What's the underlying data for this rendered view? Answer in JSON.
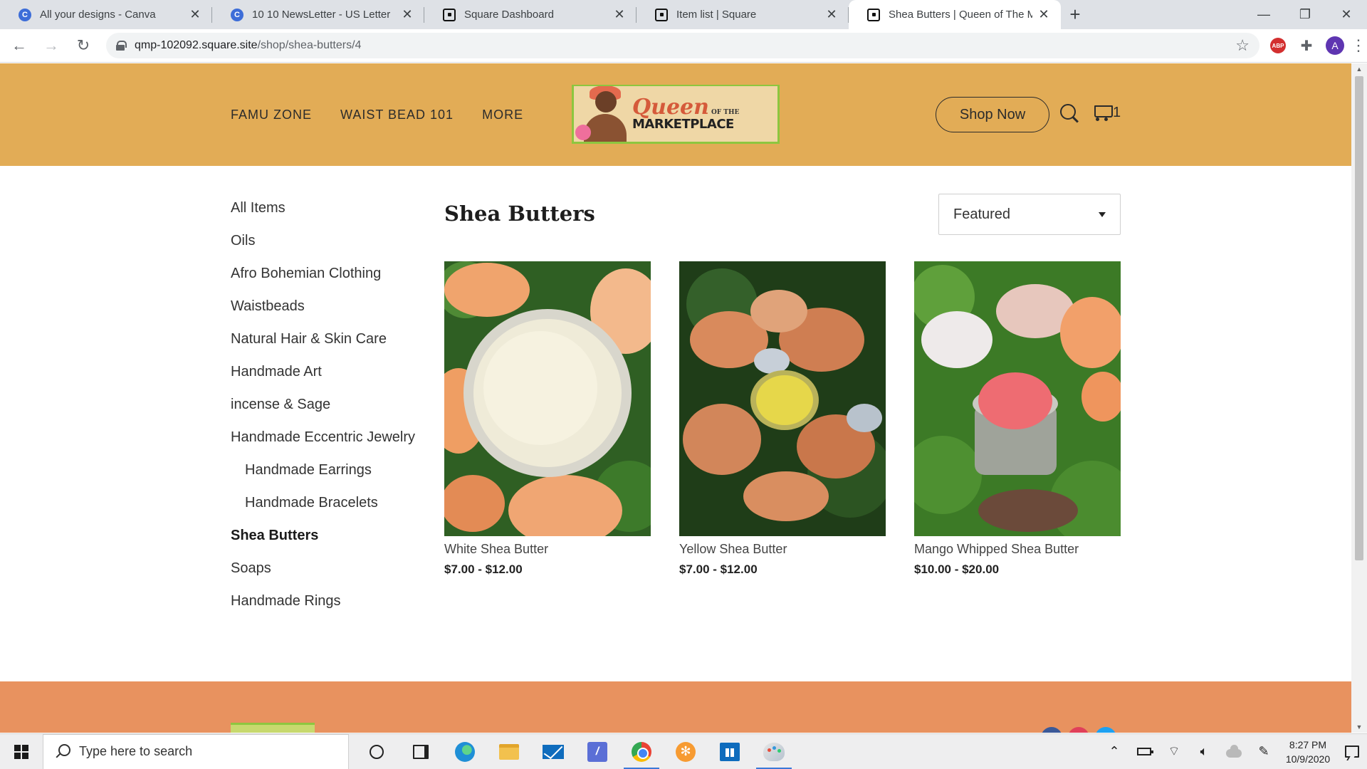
{
  "browser": {
    "tabs": [
      {
        "title": "All your designs - Canva",
        "icon": "canva-favicon",
        "active": false
      },
      {
        "title": "10 10 NewsLetter - US Letter",
        "icon": "canva-favicon",
        "active": false
      },
      {
        "title": "Square Dashboard",
        "icon": "square-favicon",
        "active": false
      },
      {
        "title": "Item list | Square",
        "icon": "square-favicon",
        "active": false
      },
      {
        "title": "Shea Butters | Queen of The Mar",
        "icon": "square-favicon",
        "active": true
      }
    ],
    "new_tab_symbol": "+",
    "window_controls": {
      "minimize": "—",
      "maximize": "❐",
      "close": "✕"
    },
    "url_host": "qmp-102092.square.site",
    "url_path": "/shop/shea-butters/4",
    "profile_initial": "A",
    "abp_label": "ABP"
  },
  "site": {
    "nav": [
      "FAMU ZONE",
      "WAIST BEAD 101",
      "MORE"
    ],
    "logo": {
      "line1": "Queen",
      "line1_small": "OF THE",
      "line2": "MARKETPLACE"
    },
    "shop_now_label": "Shop Now",
    "cart_count": "1",
    "header_color": "#e2ac56",
    "footer_color": "#e8925f"
  },
  "categories": [
    {
      "label": "All Items",
      "sub": false,
      "active": false
    },
    {
      "label": "Oils",
      "sub": false,
      "active": false
    },
    {
      "label": "Afro Bohemian Clothing",
      "sub": false,
      "active": false
    },
    {
      "label": "Waistbeads",
      "sub": false,
      "active": false
    },
    {
      "label": "Natural Hair & Skin Care",
      "sub": false,
      "active": false
    },
    {
      "label": "Handmade Art",
      "sub": false,
      "active": false
    },
    {
      "label": "incense & Sage",
      "sub": false,
      "active": false
    },
    {
      "label": "Handmade Eccentric Jewelry",
      "sub": false,
      "active": false
    },
    {
      "label": "Handmade Earrings",
      "sub": true,
      "active": false
    },
    {
      "label": "Handmade Bracelets",
      "sub": true,
      "active": false
    },
    {
      "label": "Shea Butters",
      "sub": false,
      "active": true
    },
    {
      "label": "Soaps",
      "sub": false,
      "active": false
    },
    {
      "label": "Handmade Rings",
      "sub": false,
      "active": false
    }
  ],
  "main": {
    "title": "Shea Butters",
    "sort_value": "Featured",
    "products": [
      {
        "name": "White Shea Butter",
        "price": "$7.00 - $12.00",
        "jar_color": "#f1ecd6"
      },
      {
        "name": "Yellow Shea Butter",
        "price": "$7.00 - $12.00",
        "jar_color": "#e8d64a"
      },
      {
        "name": "Mango Whipped Shea Butter",
        "price": "$10.00 - $20.00",
        "jar_color": "#ee6c72"
      }
    ]
  },
  "taskbar": {
    "search_placeholder": "Type here to search",
    "time": "8:27 PM",
    "date": "10/9/2020"
  }
}
